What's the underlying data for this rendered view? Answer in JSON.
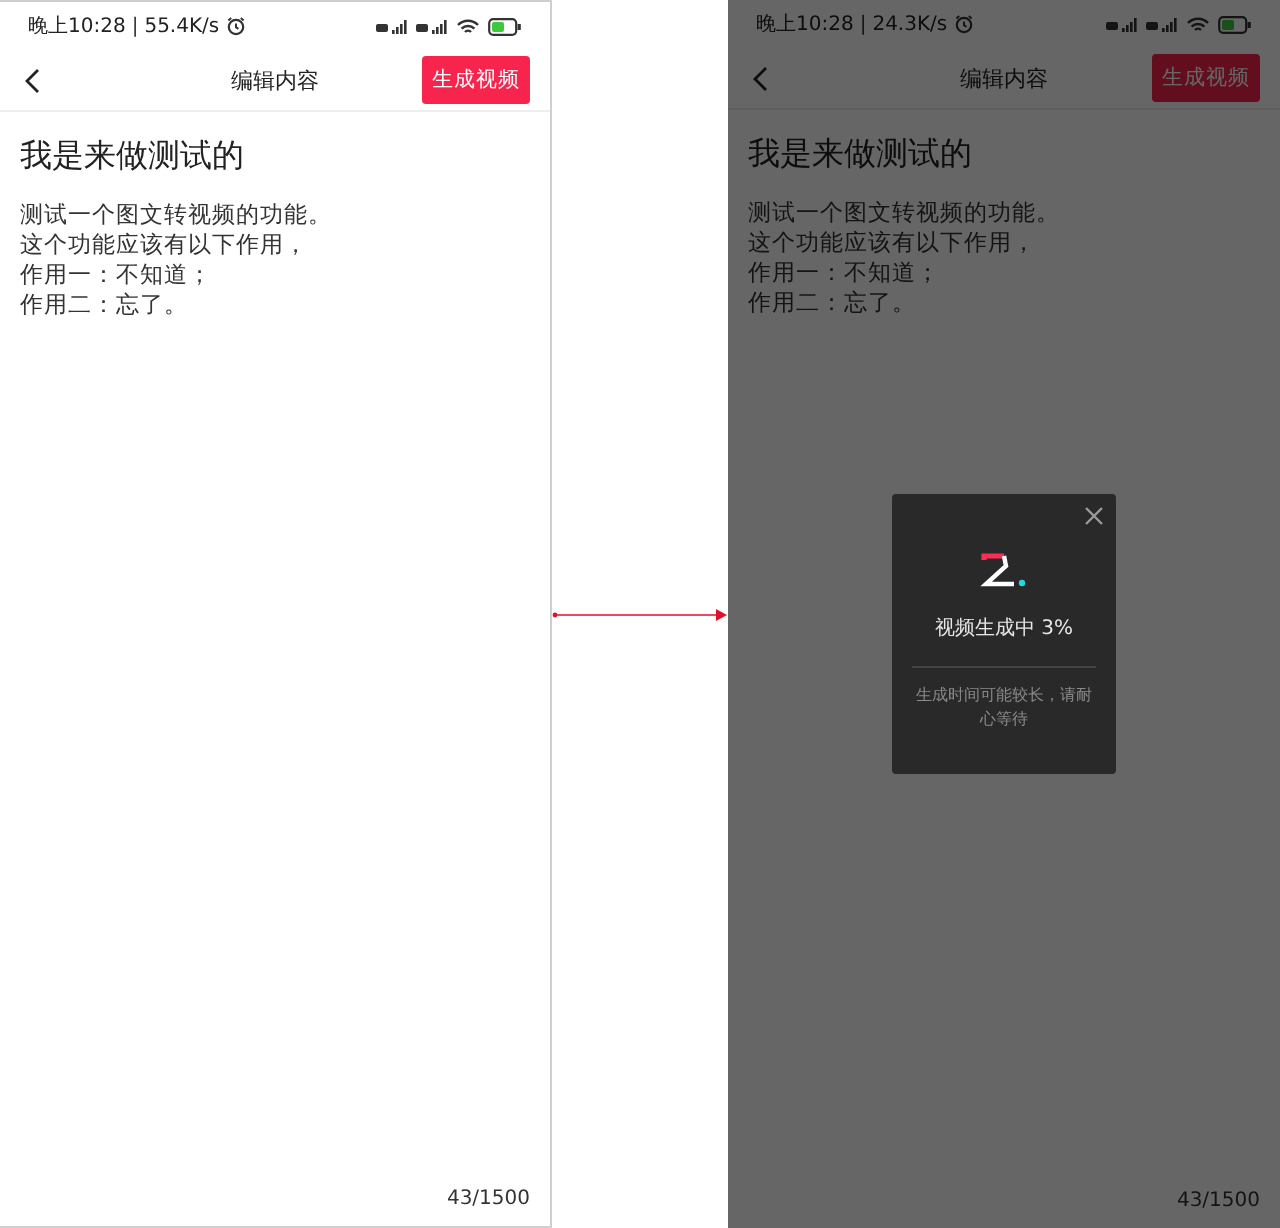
{
  "screens": [
    {
      "status": {
        "time": "晚上10:28",
        "separator": "|",
        "speed": "55.4K/s"
      },
      "nav": {
        "title": "编辑内容",
        "action": "生成视频"
      },
      "document": {
        "title": "我是来做测试的",
        "lines": [
          "测试一个图文转视频的功能。",
          "这个功能应该有以下作用，",
          "作用一：不知道；",
          "作用二：忘了。"
        ]
      },
      "counter": "43/1500",
      "dimmed": false
    },
    {
      "status": {
        "time": "晚上10:28",
        "separator": "|",
        "speed": "24.3K/s"
      },
      "nav": {
        "title": "编辑内容",
        "action": "生成视频"
      },
      "document": {
        "title": "我是来做测试的",
        "lines": [
          "测试一个图文转视频的功能。",
          "这个功能应该有以下作用，",
          "作用一：不知道；",
          "作用二：忘了。"
        ]
      },
      "counter": "43/1500",
      "dimmed": true,
      "dialog": {
        "progress": "视频生成中 3%",
        "hint": "生成时间可能较长，请耐心等待"
      }
    }
  ]
}
